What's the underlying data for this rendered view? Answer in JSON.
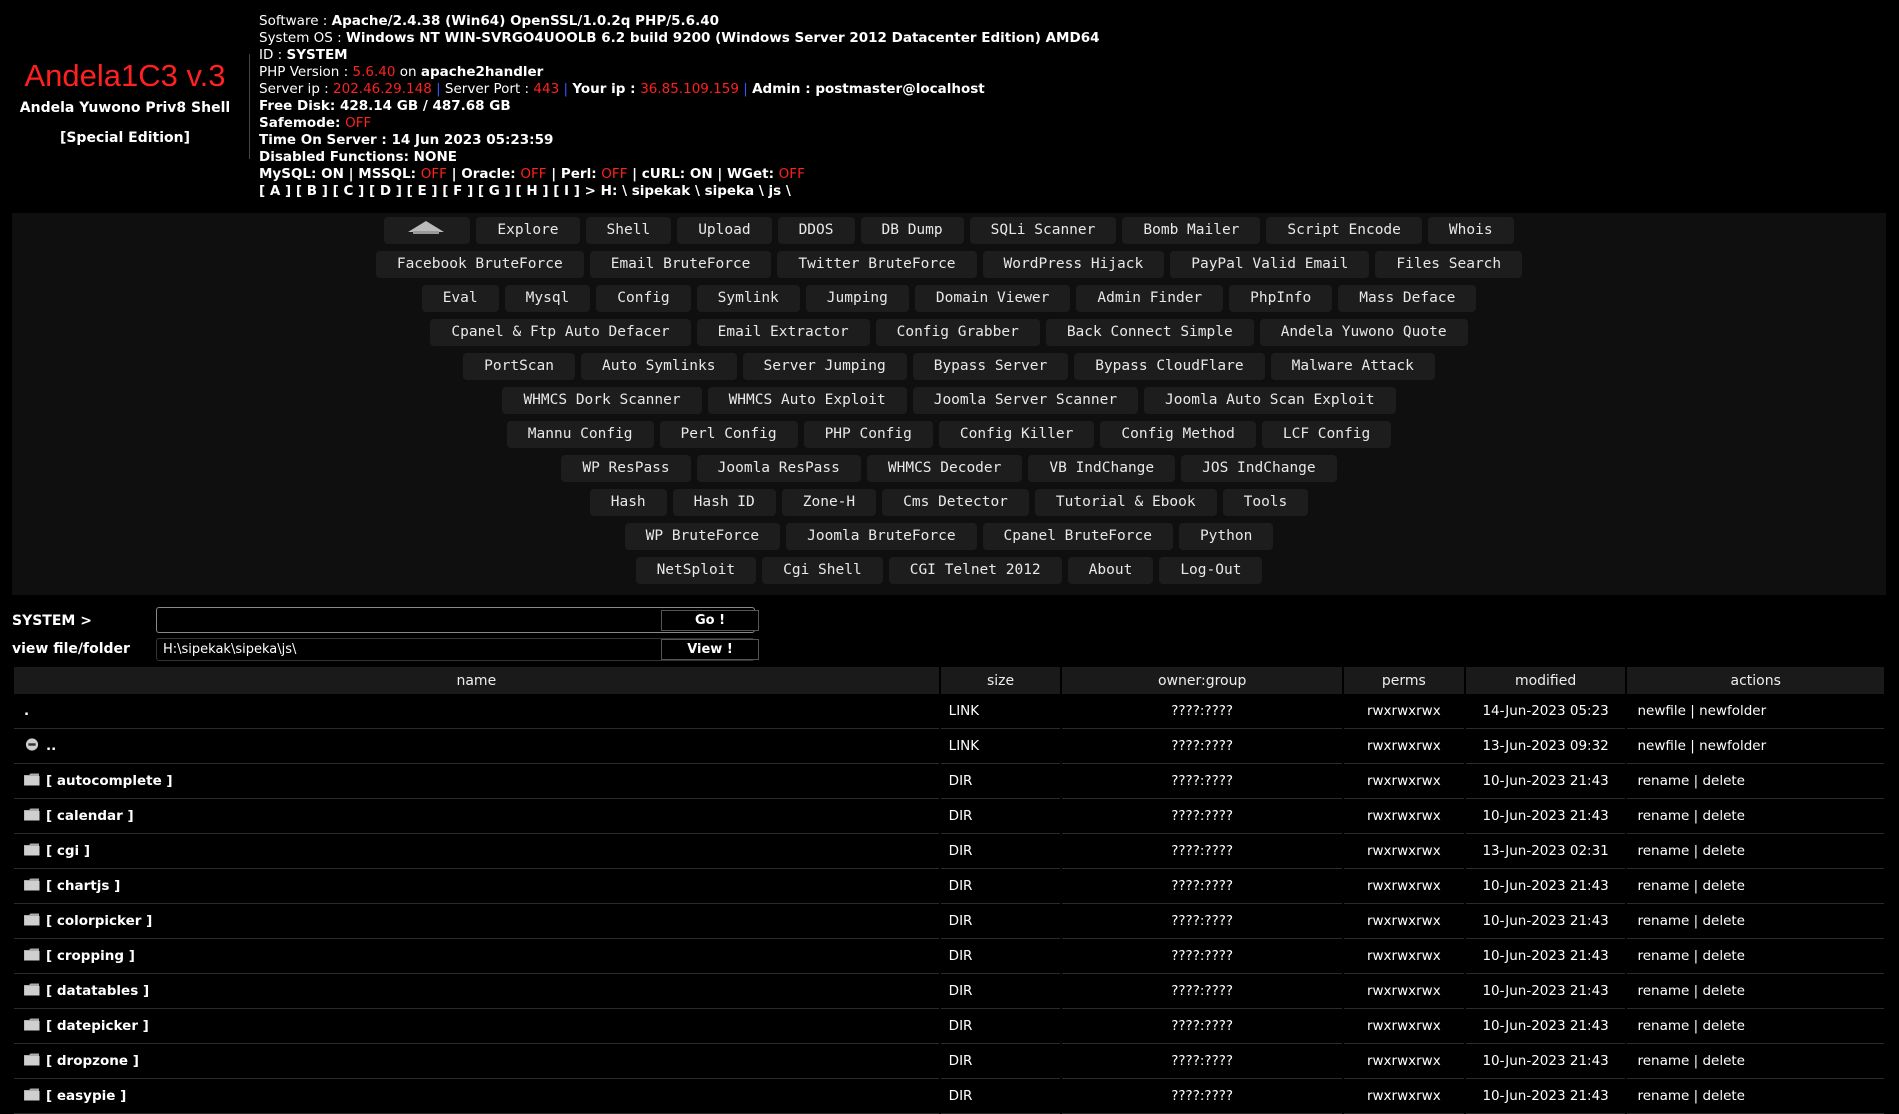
{
  "logo": {
    "title": "Andela1C3 v.3",
    "subtitle": "Andela Yuwono Priv8 Shell",
    "edition": "[Special Edition]"
  },
  "info": {
    "software_label": "Software : ",
    "software": "Apache/2.4.38 (Win64) OpenSSL/1.0.2q PHP/5.6.40",
    "os_label": "System OS : ",
    "os": "Windows NT WIN-SVRGO4UOOLB 6.2 build 9200 (Windows Server 2012 Datacenter Edition) AMD64",
    "id_label": "ID : ",
    "id": "SYSTEM",
    "php_label": "PHP Version : ",
    "php": "5.6.40",
    "php_on": " on ",
    "php_handler": "apache2handler",
    "server_ip_label": "Server ip : ",
    "server_ip": "202.46.29.148",
    "sep": " | ",
    "server_port_label": "Server Port : ",
    "server_port": "443",
    "your_ip_label": "Your ip : ",
    "your_ip": "36.85.109.159",
    "admin_label": "Admin : ",
    "admin": "postmaster@localhost",
    "free_disk": "Free Disk: 428.14 GB / 487.68 GB",
    "safemode_label": "Safemode: ",
    "safemode": "OFF",
    "time": "Time On Server : 14 Jun 2023 05:23:59",
    "disabled": "Disabled Functions: NONE",
    "mysql": "MySQL: ON",
    "mssql_label": "MSSQL: ",
    "mssql": "OFF",
    "oracle_label": "Oracle: ",
    "oracle": "OFF",
    "perl_label": "Perl: ",
    "perl": "OFF",
    "curl": "cURL: ON",
    "wget_label": "WGet: ",
    "wget": "OFF",
    "drives": "[ A ] [ B ] [ C ] [ D ] [ E ] [ F ] [ G ] [ H ] [ I ]  > H: \\ sipekak \\ sipeka \\ js \\"
  },
  "menu": [
    [
      "Explore",
      "Shell",
      "Upload",
      "DDOS",
      "DB Dump",
      "SQLi Scanner",
      "Bomb Mailer",
      "Script Encode",
      "Whois"
    ],
    [
      "Facebook BruteForce",
      "Email BruteForce",
      "Twitter BruteForce",
      "WordPress Hijack",
      "PayPal Valid Email",
      "Files Search"
    ],
    [
      "Eval",
      "Mysql",
      "Config",
      "Symlink",
      "Jumping",
      "Domain Viewer",
      "Admin Finder",
      "PhpInfo",
      "Mass Deface"
    ],
    [
      "Cpanel & Ftp Auto Defacer",
      "Email Extractor",
      "Config Grabber",
      "Back Connect Simple",
      "Andela Yuwono Quote"
    ],
    [
      "PortScan",
      "Auto Symlinks",
      "Server Jumping",
      "Bypass Server",
      "Bypass CloudFlare",
      "Malware Attack"
    ],
    [
      "WHMCS Dork Scanner",
      "WHMCS Auto Exploit",
      "Joomla Server Scanner",
      "Joomla Auto Scan Exploit"
    ],
    [
      "Mannu Config",
      "Perl Config",
      "PHP Config",
      "Config Killer",
      "Config Method",
      "LCF Config"
    ],
    [
      "WP ResPass",
      "Joomla ResPass",
      "WHMCS Decoder",
      "VB IndChange",
      "JOS IndChange"
    ],
    [
      "Hash",
      "Hash ID",
      "Zone-H",
      "Cms Detector",
      "Tutorial & Ebook",
      "Tools"
    ],
    [
      "WP BruteForce",
      "Joomla BruteForce",
      "Cpanel BruteForce",
      "Python"
    ],
    [
      "NetSploit",
      "Cgi Shell",
      "CGI Telnet 2012",
      "About",
      "Log-Out"
    ]
  ],
  "cmd": {
    "label": "SYSTEM >",
    "value": "",
    "go_label": "Go !",
    "view_label": "view file/folder",
    "path": "H:\\sipekak\\sipeka\\js\\",
    "view_button": "View !"
  },
  "table": {
    "headers": [
      "name",
      "size",
      "owner:group",
      "perms",
      "modified",
      "actions"
    ],
    "rows": [
      {
        "name": ".",
        "size": "LINK",
        "owner": "????:????",
        "perms": "rwxrwxrwx",
        "modified": "14-Jun-2023 05:23",
        "actions": "newfile | newfolder"
      },
      {
        "name": "..",
        "size": "LINK",
        "owner": "????:????",
        "perms": "rwxrwxrwx",
        "modified": "13-Jun-2023 09:32",
        "actions": "newfile | newfolder"
      },
      {
        "name": "[ autocomplete ]",
        "size": "DIR",
        "owner": "????:????",
        "perms": "rwxrwxrwx",
        "modified": "10-Jun-2023 21:43",
        "actions": "rename | delete"
      },
      {
        "name": "[ calendar ]",
        "size": "DIR",
        "owner": "????:????",
        "perms": "rwxrwxrwx",
        "modified": "10-Jun-2023 21:43",
        "actions": "rename | delete"
      },
      {
        "name": "[ cgi ]",
        "size": "DIR",
        "owner": "????:????",
        "perms": "rwxrwxrwx",
        "modified": "13-Jun-2023 02:31",
        "actions": "rename | delete"
      },
      {
        "name": "[ chartjs ]",
        "size": "DIR",
        "owner": "????:????",
        "perms": "rwxrwxrwx",
        "modified": "10-Jun-2023 21:43",
        "actions": "rename | delete"
      },
      {
        "name": "[ colorpicker ]",
        "size": "DIR",
        "owner": "????:????",
        "perms": "rwxrwxrwx",
        "modified": "10-Jun-2023 21:43",
        "actions": "rename | delete"
      },
      {
        "name": "[ cropping ]",
        "size": "DIR",
        "owner": "????:????",
        "perms": "rwxrwxrwx",
        "modified": "10-Jun-2023 21:43",
        "actions": "rename | delete"
      },
      {
        "name": "[ datatables ]",
        "size": "DIR",
        "owner": "????:????",
        "perms": "rwxrwxrwx",
        "modified": "10-Jun-2023 21:43",
        "actions": "rename | delete"
      },
      {
        "name": "[ datepicker ]",
        "size": "DIR",
        "owner": "????:????",
        "perms": "rwxrwxrwx",
        "modified": "10-Jun-2023 21:43",
        "actions": "rename | delete"
      },
      {
        "name": "[ dropzone ]",
        "size": "DIR",
        "owner": "????:????",
        "perms": "rwxrwxrwx",
        "modified": "10-Jun-2023 21:43",
        "actions": "rename | delete"
      },
      {
        "name": "[ easypie ]",
        "size": "DIR",
        "owner": "????:????",
        "perms": "rwxrwxrwx",
        "modified": "10-Jun-2023 21:43",
        "actions": "rename | delete"
      }
    ]
  },
  "icons": {
    "home": "home-icon",
    "folder": "folder-icon",
    "parent": "back-arrow-icon"
  }
}
